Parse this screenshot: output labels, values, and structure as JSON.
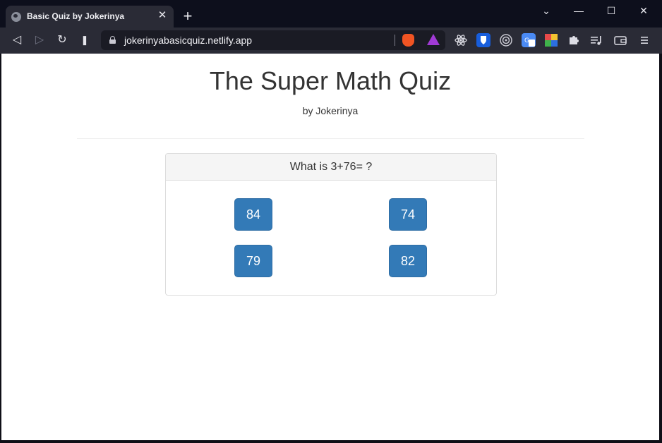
{
  "browser": {
    "tab": {
      "title": "Basic Quiz by Jokerinya",
      "close_glyph": "✕",
      "favicon": "globe-icon"
    },
    "new_tab_glyph": "+",
    "window_controls": {
      "tab_search_glyph": "⌄",
      "minimize_glyph": "—",
      "maximize_glyph": "☐",
      "close_glyph": "✕"
    },
    "toolbar": {
      "back_glyph": "◁",
      "forward_glyph": "▷",
      "reload_glyph": "↻",
      "bookmark_glyph": "❚",
      "url": "jokerinyabasicquiz.netlify.app",
      "extensions": [
        "react-devtools-icon",
        "bitwarden-icon",
        "target-icon",
        "translate-icon",
        "color-picker-icon",
        "puzzle-icon",
        "playlist-icon",
        "wallet-icon",
        "menu-icon"
      ],
      "brand_color": "#f05423",
      "rewards_color": "#a13ad6"
    }
  },
  "page": {
    "title": "The Super Math Quiz",
    "subtitle": "by Jokerinya",
    "quiz": {
      "question": "What is 3+76= ?",
      "answers": [
        "84",
        "74",
        "79",
        "82"
      ],
      "button_color": "#337ab7"
    }
  }
}
